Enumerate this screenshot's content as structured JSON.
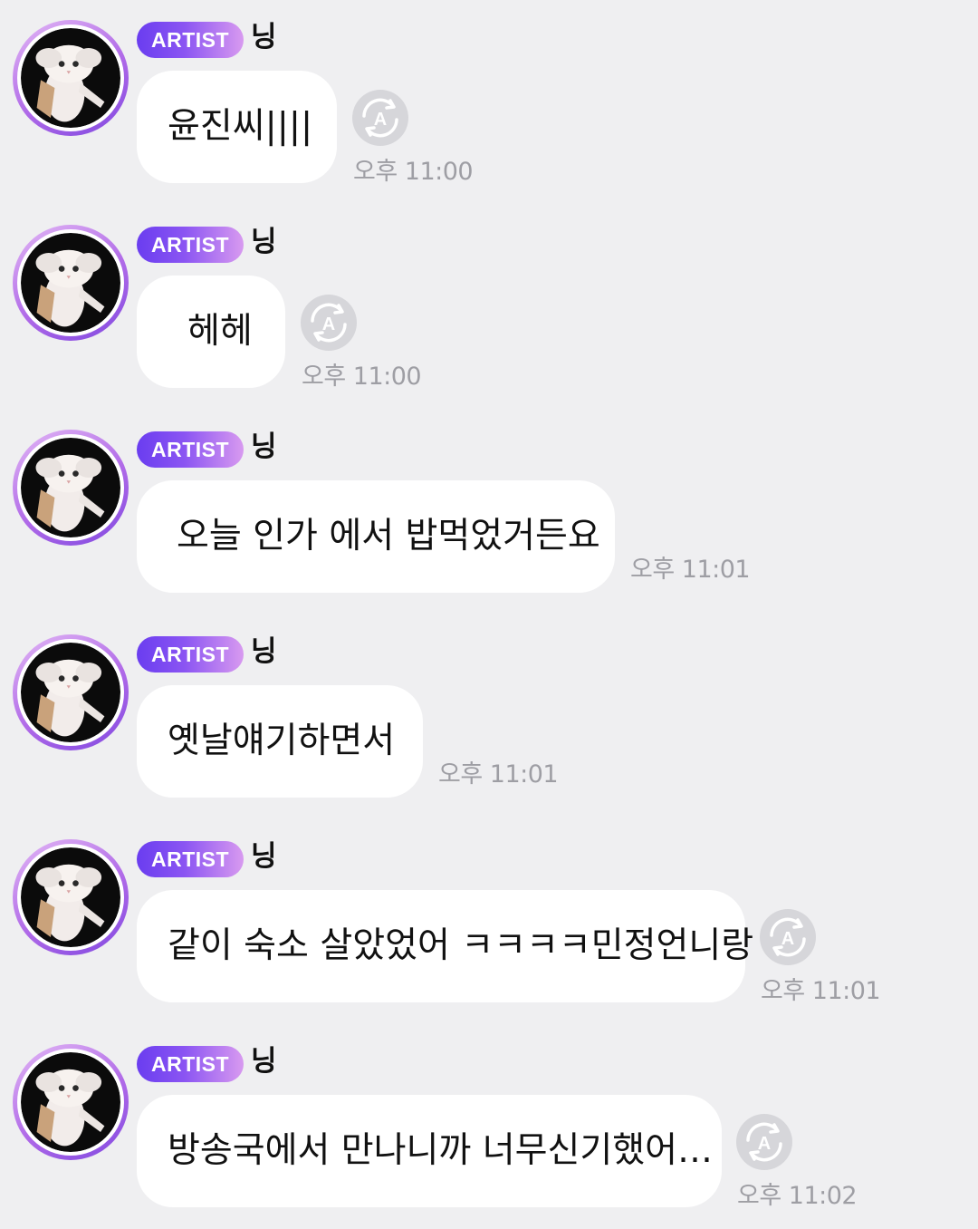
{
  "messages": [
    {
      "badge": "ARTIST",
      "sender": "닝",
      "text": "윤진씨||||",
      "time": "오후 11:00",
      "translate_icon": "translate-icon"
    },
    {
      "badge": "ARTIST",
      "sender": "닝",
      "text": "헤헤",
      "time": "오후 11:00",
      "translate_icon": "translate-icon"
    },
    {
      "badge": "ARTIST",
      "sender": "닝",
      "text": "오늘 인가 에서 밥먹었거든요",
      "time": "오후 11:01"
    },
    {
      "badge": "ARTIST",
      "sender": "닝",
      "text": "옛날얘기하면서",
      "time": "오후 11:01"
    },
    {
      "badge": "ARTIST",
      "sender": "닝",
      "text": "같이 숙소 살았었어 ㅋㅋㅋㅋ민정언니랑",
      "time": "오후 11:01",
      "translate_icon": "translate-icon"
    },
    {
      "badge": "ARTIST",
      "sender": "닝",
      "text": "방송국에서 만나니까 너무신기했어…",
      "time": "오후 11:02",
      "translate_icon": "translate-icon"
    }
  ],
  "colors": {
    "background": "#efeff1",
    "bubble": "#ffffff",
    "badge_start": "#6a3df0",
    "badge_end": "#d89af0",
    "timestamp": "#9e9ea4"
  }
}
